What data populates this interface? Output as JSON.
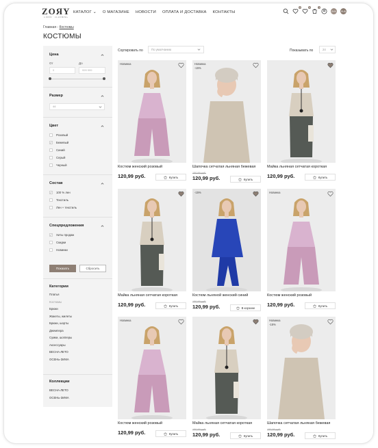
{
  "header": {
    "logo": "ZOЯY",
    "logo_sub": "LINEN · CLOTHING",
    "nav": [
      {
        "label": "КАТАЛОГ ⌄"
      },
      {
        "label": "О МАГАЗИНЕ"
      },
      {
        "label": "НОВОСТИ"
      },
      {
        "label": "ОПЛАТА И ДОСТАВКА"
      },
      {
        "label": "КОНТАКТЫ"
      }
    ],
    "badges": {
      "compare": "0",
      "favorites": "0",
      "cart": "1"
    },
    "currencies": [
      {
        "label": "BYN"
      },
      {
        "label": "RUB"
      }
    ]
  },
  "breadcrumbs": {
    "home": "Главная",
    "sep": "-",
    "current": "Костюмы"
  },
  "page_title": "КОСТЮМЫ",
  "sidebar": {
    "price": {
      "heading": "Цена",
      "from_label": "От",
      "to_label": "До",
      "from_value": "0",
      "to_placeholder": "999 999"
    },
    "size": {
      "heading": "Размер",
      "selected": "44"
    },
    "color": {
      "heading": "Цвет",
      "options": [
        {
          "label": "Розовый",
          "checked": false
        },
        {
          "label": "Бежевый",
          "checked": true
        },
        {
          "label": "Синий",
          "checked": false
        },
        {
          "label": "Серый",
          "checked": false
        },
        {
          "label": "Черный",
          "checked": false
        }
      ]
    },
    "composition": {
      "heading": "Состав",
      "options": [
        {
          "label": "100 % лен",
          "checked": true
        },
        {
          "label": "Текстиль",
          "checked": false
        },
        {
          "label": "Лен + текстиль",
          "checked": false
        }
      ]
    },
    "special": {
      "heading": "Спецпредложения",
      "options": [
        {
          "label": "Хиты продаж",
          "checked": true
        },
        {
          "label": "Скидки",
          "checked": false
        },
        {
          "label": "Новинки",
          "checked": false
        }
      ]
    },
    "show_button": "Показать",
    "reset_button": "Сбросить",
    "categories": {
      "heading": "Категории",
      "items": [
        {
          "label": "Платья"
        },
        {
          "label": "Костюмы"
        },
        {
          "label": "Брюки"
        },
        {
          "label": "Жакеты, жилеты"
        },
        {
          "label": "Брюки, шорты"
        },
        {
          "label": "Джемпера"
        },
        {
          "label": "Сумки, шопперы"
        },
        {
          "label": "Аксессуары"
        },
        {
          "label": "ВЕСНА-ЛЕТО"
        },
        {
          "label": "ОСЕНЬ-ЗИМА"
        }
      ]
    },
    "collections": {
      "heading": "Коллекции",
      "items": [
        {
          "label": "ВЕСНА-ЛЕТО"
        },
        {
          "label": "ОСЕНЬ-ЗИМА"
        }
      ]
    }
  },
  "toolbar": {
    "sort_label": "Сортировать по",
    "sort_value": "По умолчанию",
    "show_label": "Показывать по",
    "show_value": "24"
  },
  "products": [
    {
      "name": "Костюм женский розовый",
      "price": "120,99 руб.",
      "old_price": "",
      "tag": "Новинка",
      "discount": "",
      "button": "Купить",
      "heart_filled": false,
      "kind": "pink-suit"
    },
    {
      "name": "Шапочка сетчатая льняная бежевая",
      "price": "120,99 руб.",
      "old_price": "150,99 руб.",
      "tag": "Новинка",
      "discount": "-15%",
      "button": "Купить",
      "heart_filled": false,
      "kind": "hat"
    },
    {
      "name": "Майка льняная сетчатая короткая",
      "price": "120,99 руб.",
      "old_price": "",
      "tag": "",
      "discount": "",
      "button": "Купить",
      "heart_filled": true,
      "kind": "beige-top"
    },
    {
      "name": "Майка льняная сетчатая короткая",
      "price": "120,99 руб.",
      "old_price": "",
      "tag": "",
      "discount": "",
      "button": "Купить",
      "heart_filled": true,
      "kind": "beige-top"
    },
    {
      "name": "Костюм льняной женский синий",
      "price": "120,99 руб.",
      "old_price": "150,99 руб.",
      "tag": "-15%",
      "discount": "",
      "button": "В корзине",
      "heart_filled": true,
      "kind": "blue-suit"
    },
    {
      "name": "Костюм женский розовый",
      "price": "120,99 руб.",
      "old_price": "",
      "tag": "Новинка",
      "discount": "",
      "button": "Купить",
      "heart_filled": false,
      "kind": "pink-suit"
    },
    {
      "name": "Костюм женский розовый",
      "price": "120,99 руб.",
      "old_price": "",
      "tag": "Новинка",
      "discount": "",
      "button": "Купить",
      "heart_filled": false,
      "kind": "pink-suit"
    },
    {
      "name": "Майка льняная сетчатая короткая",
      "price": "120,99 руб.",
      "old_price": "150,99 руб.",
      "tag": "",
      "discount": "",
      "button": "Купить",
      "heart_filled": true,
      "kind": "beige-top"
    },
    {
      "name": "Шапочка сетчатая льняная бежевая",
      "price": "120,99 руб.",
      "old_price": "150,99 руб.",
      "tag": "Новинка",
      "discount": "-15%",
      "button": "Купить",
      "heart_filled": false,
      "kind": "hat"
    }
  ],
  "colors": {
    "accent": "#8e7f74",
    "text": "#2b2b2b",
    "sidebar_bg": "#f3f3f3"
  }
}
